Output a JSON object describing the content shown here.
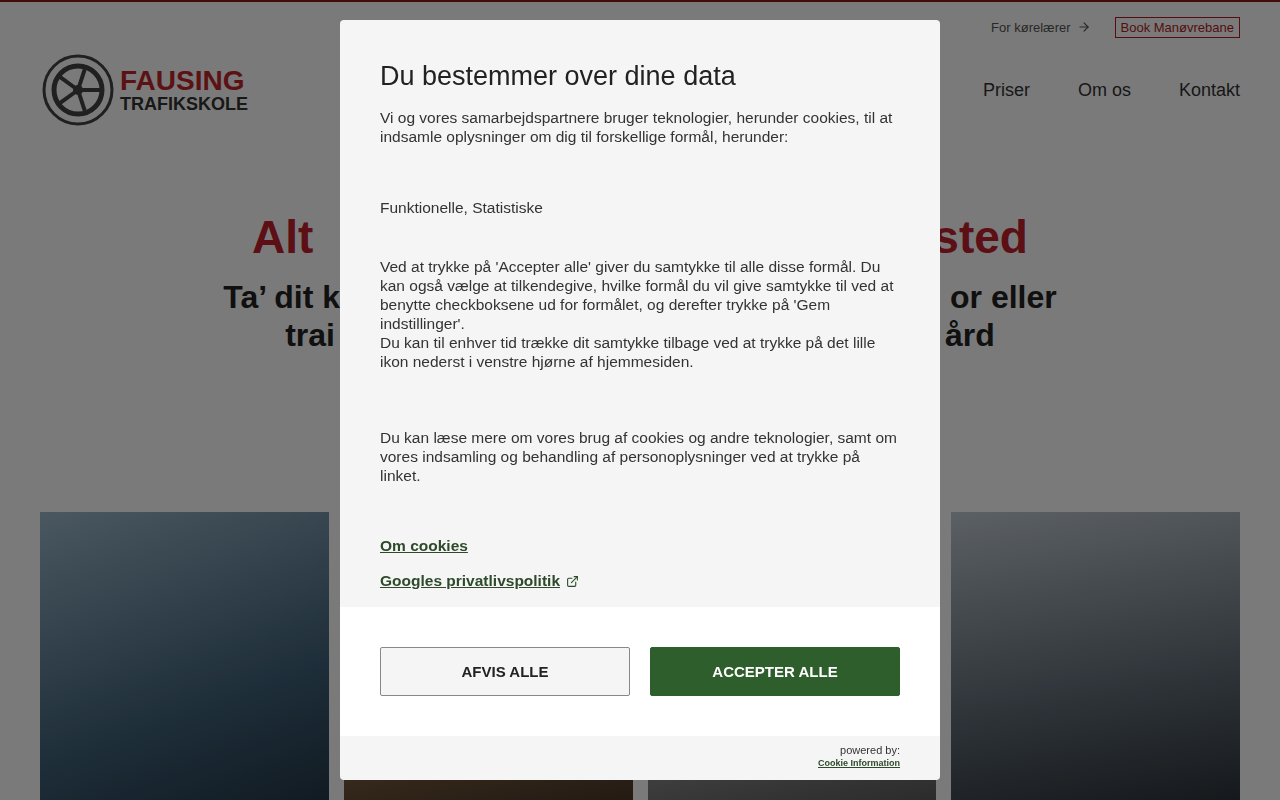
{
  "topbar": {
    "links": [
      {
        "label": "For kørelærer",
        "kind": "arrow"
      },
      {
        "label": "Book Manøvrebane",
        "kind": "boxed"
      }
    ]
  },
  "logo": {
    "name": "FAUSING",
    "sub": "TRAFIKSKOLE"
  },
  "nav": [
    "Priser",
    "Om os",
    "Kontakt"
  ],
  "hero": {
    "title": [
      "Alt",
      "sted"
    ],
    "subtitle": [
      [
        "Ta’ dit k",
        "or eller"
      ],
      [
        "trai",
        "ård"
      ]
    ]
  },
  "dialog": {
    "title": "Du bestemmer over dine data",
    "intro": "Vi og vores samarbejdspartnere bruger teknologier, herunder cookies, til at indsamle oplysninger om dig til forskellige formål, herunder:",
    "purposes": "Funktionelle, Statistiske",
    "consent": [
      "Ved at trykke på 'Accepter alle' giver du samtykke til alle disse formål. Du kan også vælge at tilkendegive, hvilke formål du vil give samtykke til ved at benytte checkboksene ud for formålet, og derefter trykke på 'Gem indstillinger'.",
      "Du kan til enhver tid trække dit samtykke tilbage ved at trykke på det lille ikon nederst i venstre hjørne af hjemmesiden."
    ],
    "more": "Du kan læse mere om vores brug af cookies og andre teknologier, samt om vores indsamling og behandling af personoplysninger ved at trykke på linket.",
    "links": [
      {
        "label": "Om cookies",
        "external": false
      },
      {
        "label": "Googles privatlivspolitik",
        "external": true
      }
    ],
    "buttons": [
      {
        "label": "AFVIS ALLE",
        "kind": "secondary"
      },
      {
        "label": "ACCEPTER ALLE",
        "kind": "primary"
      }
    ],
    "powered": {
      "label": "powered by:",
      "brand": "Cookie Information"
    }
  }
}
